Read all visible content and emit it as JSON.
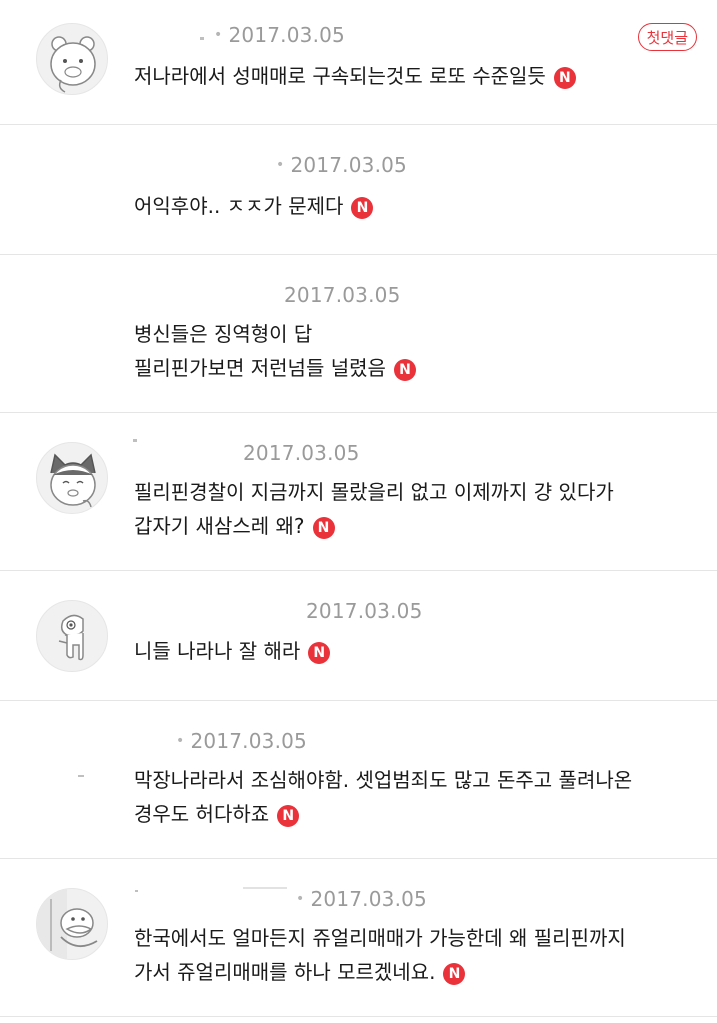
{
  "comments": [
    {
      "date": "2017.03.05",
      "badge_first": "첫댓글",
      "lines": [
        "저나라에서 성매매로 구속되는것도 로또 수준일듯"
      ],
      "new_badge": "N",
      "avatar_icon": "bear-character-icon"
    },
    {
      "date": "2017.03.05",
      "lines": [
        "어익후야.. ㅈㅈ가 문제다"
      ],
      "new_badge": "N"
    },
    {
      "date": "2017.03.05",
      "lines": [
        "병신들은 징역형이 답",
        "필리핀가보면 저런넘들 널렸음"
      ],
      "new_badge": "N"
    },
    {
      "date": "2017.03.05",
      "lines": [
        "필리핀경찰이 지금까지 몰랐을리 없고 이제까지 걍 있다가",
        "갑자기 새삼스레 왜?"
      ],
      "new_badge": "N",
      "avatar_icon": "cat-character-icon"
    },
    {
      "date": "2017.03.05",
      "lines": [
        "니들 나라나 잘 해라"
      ],
      "new_badge": "N",
      "avatar_icon": "crocodile-character-icon"
    },
    {
      "date": "2017.03.05",
      "lines": [
        "막장나라라서 조심해야함. 셋업범죄도 많고 돈주고 풀려나온",
        "경우도 허다하죠"
      ],
      "new_badge": "N"
    },
    {
      "date": "2017.03.05",
      "lines": [
        "한국에서도 얼마든지 쥬얼리매매가 가능한데 왜 필리핀까지",
        "가서 쥬얼리매매를 하나 모르겠네요."
      ],
      "new_badge": "N",
      "avatar_icon": "duck-character-icon"
    }
  ]
}
